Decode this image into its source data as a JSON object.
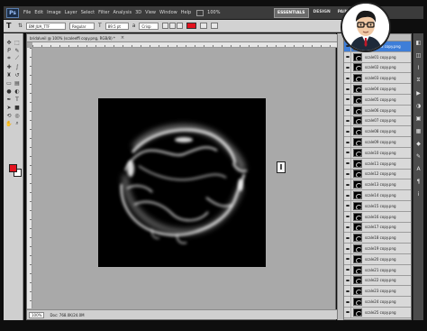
{
  "menubar": {
    "app_logo": "Ps",
    "items": [
      "File",
      "Edit",
      "Image",
      "Layer",
      "Select",
      "Filter",
      "Analysis",
      "3D",
      "View",
      "Window",
      "Help"
    ],
    "zoom": "100%",
    "workspaces": [
      "ESSENTIALS",
      "DESIGN",
      "PAINTING"
    ]
  },
  "options": {
    "font_family": "BM JUA_TTF",
    "font_style": "Regular",
    "font_size": "89.5 pt",
    "antialias": "Crisp",
    "text_color": "#e3121e"
  },
  "tools": {
    "foreground_color": "#e3121e",
    "background_color": "#ffffff"
  },
  "document": {
    "tab_title": "bridalveil @ 100% (scaleeffi copy.png, RGB/8) *",
    "cursor_glyph": "I",
    "status": {
      "zoom": "100%",
      "info": "Doc: 768.0K/24.0M"
    }
  },
  "layers": {
    "rows": [
      {
        "name": "scale1003 copy.png",
        "active": true
      },
      {
        "name": "scale01 copy.png",
        "active": false
      },
      {
        "name": "scale02 copy.png",
        "active": false
      },
      {
        "name": "scale03 copy.png",
        "active": false
      },
      {
        "name": "scale04 copy.png",
        "active": false
      },
      {
        "name": "scale05 copy.png",
        "active": false
      },
      {
        "name": "scale06 copy.png",
        "active": false
      },
      {
        "name": "scale07 copy.png",
        "active": false
      },
      {
        "name": "scale08 copy.png",
        "active": false
      },
      {
        "name": "scale09 copy.png",
        "active": false
      },
      {
        "name": "scale10 copy.png",
        "active": false
      },
      {
        "name": "scale11 copy.png",
        "active": false
      },
      {
        "name": "scale12 copy.png",
        "active": false
      },
      {
        "name": "scale13 copy.png",
        "active": false
      },
      {
        "name": "scale14 copy.png",
        "active": false
      },
      {
        "name": "scale15 copy.png",
        "active": false
      },
      {
        "name": "scale16 copy.png",
        "active": false
      },
      {
        "name": "scale17 copy.png",
        "active": false
      },
      {
        "name": "scale18 copy.png",
        "active": false
      },
      {
        "name": "scale19 copy.png",
        "active": false
      },
      {
        "name": "scale20 copy.png",
        "active": false
      },
      {
        "name": "scale21 copy.png",
        "active": false
      },
      {
        "name": "scale22 copy.png",
        "active": false
      },
      {
        "name": "scale23 copy.png",
        "active": false
      },
      {
        "name": "scale24 copy.png",
        "active": false
      },
      {
        "name": "scale25 copy.png",
        "active": false
      }
    ]
  },
  "icons": {
    "tools": [
      "move-icon",
      "marquee-icon",
      "lasso-icon",
      "quick-select-icon",
      "crop-icon",
      "eyedropper-icon",
      "healing-icon",
      "brush-icon",
      "stamp-icon",
      "history-brush-icon",
      "eraser-icon",
      "gradient-icon",
      "blur-icon",
      "dodge-icon",
      "pen-icon",
      "type-icon",
      "path-select-icon",
      "shape-icon",
      "3d-rotate-icon",
      "3d-orbit-icon",
      "hand-icon",
      "zoom-icon"
    ],
    "side": [
      "layers-icon",
      "channels-icon",
      "paths-icon",
      "history-icon",
      "actions-icon",
      "adjustments-icon",
      "masks-icon",
      "swatches-icon",
      "styles-icon",
      "brush-panel-icon",
      "character-icon",
      "paragraph-icon",
      "info-icon"
    ]
  }
}
